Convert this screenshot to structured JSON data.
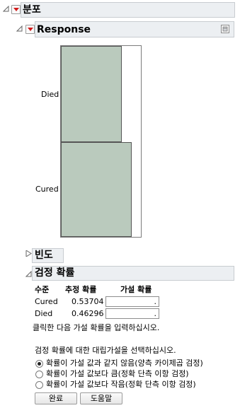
{
  "distribution": {
    "title": "분포"
  },
  "response": {
    "title": "Response",
    "categories": [
      {
        "label": "Died",
        "probability": 0.46296
      },
      {
        "label": "Cured",
        "probability": 0.53704
      }
    ],
    "colors": {
      "bar_fill": "#bacabd",
      "bar_border": "#555555"
    }
  },
  "frequency": {
    "title": "빈도"
  },
  "test_probabilities": {
    "title": "검정 확률",
    "headers": {
      "level": "수준",
      "estimated": "추정 확률",
      "hypothesized": "가설 확률"
    },
    "rows": [
      {
        "level": "Cured",
        "estimated": "0.53704",
        "hypothesized": "."
      },
      {
        "level": "Died",
        "estimated": "0.46296",
        "hypothesized": "."
      }
    ],
    "instruction": "클릭한 다음 가설 확률을 입력하십시오.",
    "alt_prompt": "검정 확률에 대한 대립가설을 선택하십시오.",
    "options": [
      {
        "label": "확률이 가설 값과 같지 않음(양측 카이제곱 검정)",
        "selected": true
      },
      {
        "label": "확률이 가설 값보다 큼(정확 단측 이항 검정)",
        "selected": false
      },
      {
        "label": "확률이 가설 값보다 작음(정확 단측 이항 검정)",
        "selected": false
      }
    ],
    "buttons": {
      "done": "완료",
      "help": "도움말"
    }
  }
}
